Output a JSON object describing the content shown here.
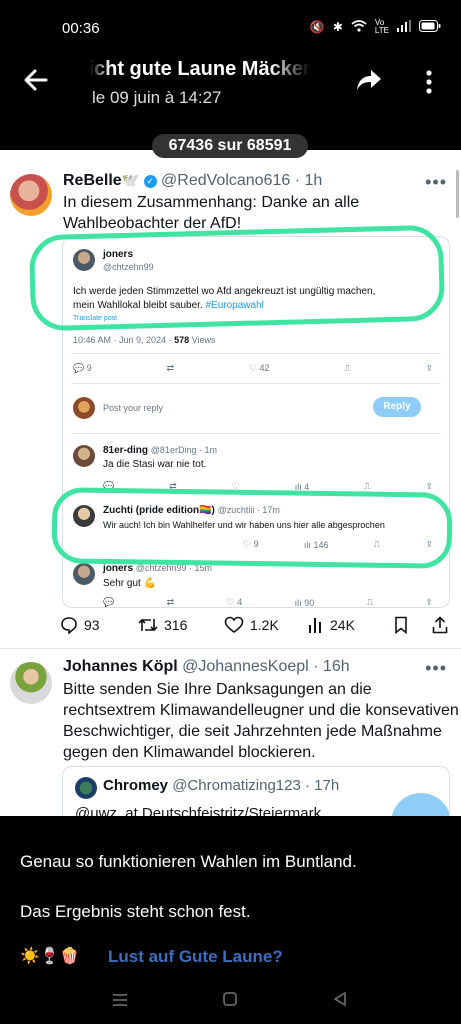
{
  "status_bar": {
    "time": "00:36",
    "battery": ""
  },
  "header": {
    "title": "Nicht gute Laune   Mäckerei",
    "subtitle": "le 09 juin à 14:27",
    "counter": "67436 sur 68591"
  },
  "post1": {
    "name": "ReBelle",
    "name_emoji": "🕊️",
    "handle": "@RedVolcano616",
    "time": "· 1h",
    "text_line1": "In diesem Zusammenhang: Danke an alle",
    "text_line2": "Wahlbeobachter der AfD!",
    "embed": {
      "author_name": "joners",
      "author_handle": "@chtzehn99",
      "text_line1": "Ich werde jeden Stimmzettel wo Afd angekreuzt ist ungültig machen,",
      "text_line2": "mein Wahllokal bleibt sauber.",
      "hashtag": "#Europawahl",
      "translate": "Translate post",
      "meta_time": "10:46 AM · Jun 9, 2024 ·",
      "views_count": "578",
      "views_label": "Views",
      "actions": {
        "replies": "9",
        "likes": "42"
      },
      "reply_placeholder": "Post your reply",
      "reply_button": "Reply",
      "replies": [
        {
          "name": "81er-ding",
          "handle": "@81erDing · 1m",
          "text": "Ja die Stasi war nie tot.",
          "likes": "",
          "views": "4"
        },
        {
          "name": "Zuchti (pride edition🏳️‍🌈)",
          "handle": "@zuchtiii · 17m",
          "text": "Wir auch! Ich bin Wahlhelfer und wir haben uns hier alle abgesprochen",
          "likes": "9",
          "views": "146"
        },
        {
          "name": "joners",
          "handle": "@chtzehn99 · 15m",
          "text": "Sehr gut 💪",
          "likes": "4",
          "views": "90"
        }
      ]
    },
    "actions": {
      "replies": "93",
      "retweets": "316",
      "likes": "1.2K",
      "views": "24K"
    }
  },
  "post2": {
    "name": "Johannes Köpl",
    "handle": "@JohannesKoepl",
    "time": "· 16h",
    "text_line1": "Bitte senden Sie Ihre Danksagungen an die",
    "text_line2": "rechtsextrem Klimawandelleugner und die konsevativen",
    "text_line3": "Beschwichtiger, die seit Jahrzehnten jede Maßnahme",
    "text_line4": "gegen den Klimawandel blockieren.",
    "quote": {
      "name": "Chromey",
      "handle": "@Chromatizing123",
      "time": "· 17h",
      "text": "@uwz_at Deutschfeistritz/Steiermark"
    }
  },
  "caption": {
    "line1": "Genau so funktionieren Wahlen im Buntland.",
    "line2": "Das Ergebnis steht schon fest.",
    "emojis": "☀️🍷🍿",
    "link": "Lust auf Gute Laune?"
  },
  "colors": {
    "highlight": "#3fe3a2",
    "link": "#1d9bf0",
    "caption_link": "#3a6fc0"
  }
}
